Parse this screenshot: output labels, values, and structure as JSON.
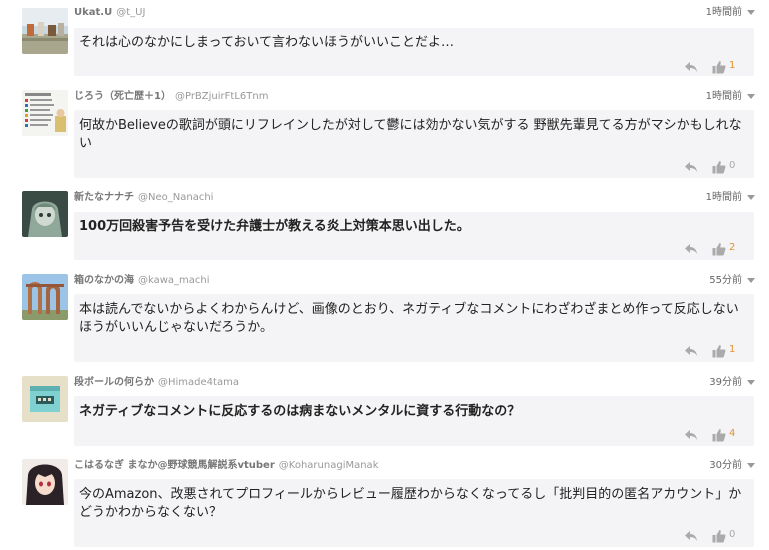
{
  "comments": [
    {
      "name": "Ukat.U",
      "handle": "@t_UJ",
      "time": "1時間前",
      "text": "それは心のなかにしまっておいて言わないほうがいいことだよ…",
      "bold": false,
      "likes": "1",
      "likes_color": "#e3922f",
      "avatar_icon": "landscape-photo-avatar"
    },
    {
      "name": "じろう（死亡歴＋1）",
      "handle": "@PrBZjuirFtL6Tnm",
      "time": "1時間前",
      "text": "何故かBelieveの歌詞が頭にリフレインしたが対して鬱には効かない気がする 野獣先輩見てる方がマシかもしれない",
      "bold": false,
      "likes": "0",
      "likes_color": "#aaaaaa",
      "avatar_icon": "document-avatar"
    },
    {
      "name": "新たなナナチ",
      "handle": "@Neo_Nanachi",
      "time": "1時間前",
      "text": "100万回殺害予告を受けた弁護士が教える炎上対策本思い出した。",
      "bold": true,
      "likes": "2",
      "likes_color": "#e3922f",
      "avatar_icon": "anime-character-avatar"
    },
    {
      "name": "箱のなかの海",
      "handle": "@kawa_machi",
      "time": "55分前",
      "text": "本は読んでないからよくわからんけど、画像のとおり、ネガティブなコメントにわざわざまとめ作って反応しないほうがいいんじゃないだろうか。",
      "bold": false,
      "likes": "1",
      "likes_color": "#e3922f",
      "avatar_icon": "ruins-photo-avatar"
    },
    {
      "name": "段ボールの何らか",
      "handle": "@Himade4tama",
      "time": "39分前",
      "text": "ネガティブなコメントに反応するのは病まないメンタルに資する行動なの？",
      "bold": true,
      "likes": "4",
      "likes_color": "#e3922f",
      "avatar_icon": "cardboard-box-avatar"
    },
    {
      "name": "こはるなぎ まなか@野球競馬解説系vtuber",
      "handle": "@KoharunagiManak",
      "time": "30分前",
      "text": "今のAmazon、改悪されてプロフィールからレビュー履歴わからなくなってるし「批判目的の匿名アカウント」かどうかわからなくない？",
      "bold": false,
      "likes": "0",
      "likes_color": "#aaaaaa",
      "avatar_icon": "vtuber-avatar"
    }
  ]
}
